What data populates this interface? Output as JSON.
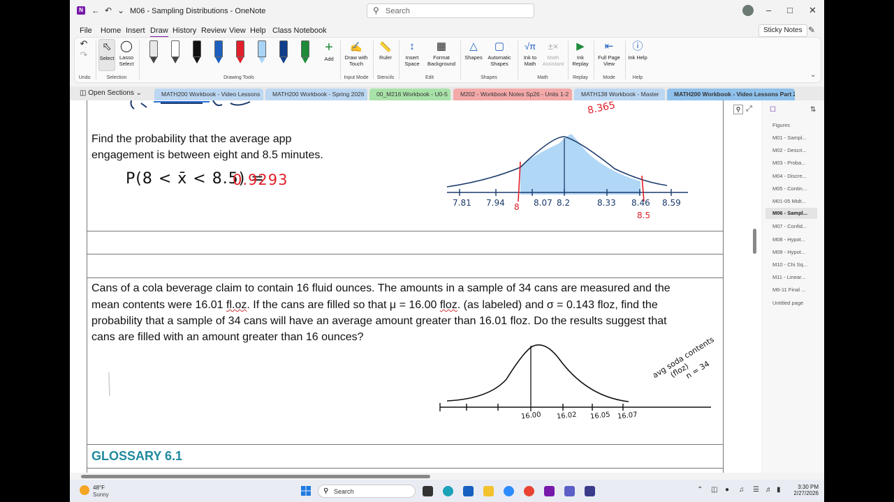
{
  "window": {
    "title": "M06 - Sampling Distributions  -  OneNote",
    "search_placeholder": "Search"
  },
  "menu": [
    "File",
    "Home",
    "Insert",
    "Draw",
    "History",
    "Review",
    "View",
    "Help",
    "Class Notebook"
  ],
  "menu_active": "Draw",
  "sticky_notes": "Sticky Notes",
  "ribbon": {
    "undo_label": "Undo",
    "select": "Select",
    "lasso": "Lasso Select",
    "selection_group": "Selection",
    "drawing_tools_group": "Drawing Tools",
    "add": "Add",
    "draw_with_touch": "Draw with Touch",
    "input_mode_group": "Input Mode",
    "ruler": "Ruler",
    "stencils_group": "Stencils",
    "insert_space": "Insert Space",
    "format_background": "Format Background",
    "edit_group": "Edit",
    "shapes": "Shapes",
    "automatic_shapes": "Automatic Shapes",
    "shapes_group": "Shapes",
    "ink_to_math": "Ink to Math",
    "math_assistant": "Math Assistant",
    "math_group": "Math",
    "ink_replay": "Ink Replay",
    "replay_group": "Replay",
    "full_page_view": "Full Page View",
    "mode_group": "Mode",
    "ink_help": "Ink Help",
    "help_group": "Help",
    "pens": [
      {
        "color": "#e8e8e8"
      },
      {
        "color": "#ffffff"
      },
      {
        "color": "#111111"
      },
      {
        "color": "#1d5fbf"
      },
      {
        "color": "#e0202a"
      },
      {
        "color": "#a8d4f5"
      },
      {
        "color": "#123e8c"
      },
      {
        "color": "#1e8a3a"
      }
    ]
  },
  "sections": {
    "open_sections": "Open Sections",
    "tabs": [
      {
        "label": "MATH200 Workbook - Video Lessons",
        "color": "#bcd7f2"
      },
      {
        "label": "MATH200 Workbook - Spring 2026",
        "color": "#bcd7f2"
      },
      {
        "label": "00_M216 Workbook - U0-5",
        "color": "#a9e2a8"
      },
      {
        "label": "M202 - Workbook Notes Sp26 - Units 1-2",
        "color": "#f4a9a9"
      },
      {
        "label": "MATH138 Workbook - Master",
        "color": "#bcd7f2"
      },
      {
        "label": "MATH200 Workbook - Video Lessons Part 2",
        "color": "#8fc1ec"
      }
    ]
  },
  "page": {
    "problem1_line1": "Find the probability that the average app",
    "problem1_line2": "engagement is between eight and 8.5 minutes.",
    "ink1_lhs": "P(8 < x̄ < 8.5) =",
    "ink1_answer": "0.9293",
    "ink1_top_value": "8.365",
    "axis1_ticks": [
      "7.81",
      "7.94",
      "8.07",
      "8.2",
      "8.33",
      "8.46",
      "8.59"
    ],
    "axis1_red_left": "8",
    "axis1_red_right": "8.5",
    "problem2_line1": "Cans of a cola beverage claim to contain 16 fluid ounces. The amounts in a sample of 34 cans are measured and the",
    "problem2_line2_a": "mean contents were 16.01 ",
    "problem2_line2_flz": "fl.oz",
    "problem2_line2_b": ". If the cans are filled so that μ = 16.00 ",
    "problem2_line2_floz": "floz",
    "problem2_line2_c": ". (as labeled) and σ = 0.143 floz, find the",
    "problem2_line3": "probability that a sample of 34 cans will have an average amount greater than 16.01 floz. Do the results suggest that",
    "problem2_line4": "cans are filled with an amount greater than 16 ounces?",
    "axis2_ticks": [
      "16.00",
      "16.02",
      "16.05",
      "16.07"
    ],
    "axis2_label_line1": "avg soda contents",
    "axis2_label_line2": "(floz)",
    "axis2_label_line3": "n = 34",
    "glossary": "GLOSSARY 6.1"
  },
  "pages_panel": {
    "header": "Figures",
    "items": [
      "M01 - Sampl...",
      "M02 - Descri...",
      "M03 - Proba...",
      "M04 - Discre...",
      "M05 - Contin...",
      "M01-05 Midt...",
      "M06 - Sampl...",
      "M07 - Confid...",
      "M08 - Hypot...",
      "M09 - Hypot...",
      "M10 - Chi Sq...",
      "M11 - Linear...",
      "M6-11 Final ...",
      "Untitled page"
    ],
    "active_index": 6
  },
  "taskbar": {
    "temp": "48°F",
    "weather": "Sunny",
    "search": "Search",
    "time": "3:30 PM",
    "date": "2/27/2026"
  }
}
